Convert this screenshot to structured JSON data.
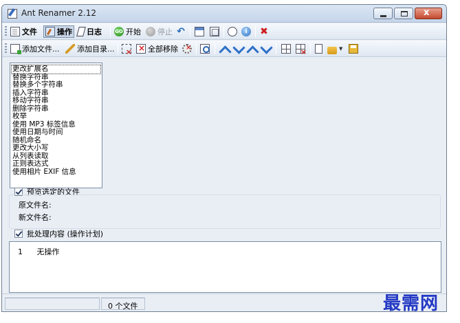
{
  "window": {
    "title": "Ant Renamer 2.12"
  },
  "toolbar_main": {
    "file": "文件",
    "operations": "操作",
    "log": "日志",
    "start": "开始",
    "stop": "停止"
  },
  "toolbar_files": {
    "add_files": "添加文件...",
    "add_folders": "添加目录...",
    "remove_all": "全部移除"
  },
  "operations": [
    "更改扩展名",
    "替换字符串",
    "替换多个字符串",
    "插入字符串",
    "移动字符串",
    "删除字符串",
    "枚举",
    "使用 MP3 标签信息",
    "使用日期与时间",
    "随机命名",
    "更改大小写",
    "从列表读取",
    "正则表达式",
    "使用相片 EXIF 信息"
  ],
  "preview": {
    "label": "预览选定的文件",
    "checked": true,
    "old_name_label": "原文件名:",
    "new_name_label": "新文件名:"
  },
  "batch": {
    "label": "批处理内容 (操作计划)",
    "checked": true,
    "rows": [
      {
        "num": "1",
        "text": "无操作"
      }
    ]
  },
  "status": {
    "file_count": "0 个文件"
  },
  "watermark": "最需网",
  "colors": {
    "accent": "#2e6fc7",
    "watermark": "#2439c4",
    "close": "#c44a2d"
  }
}
